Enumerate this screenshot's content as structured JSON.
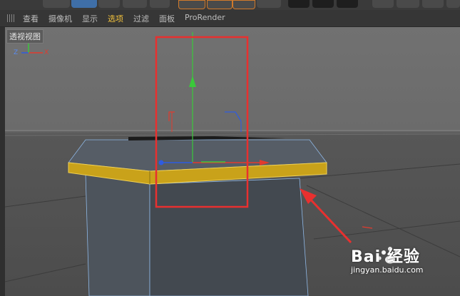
{
  "menu": {
    "items": [
      {
        "label": "查看"
      },
      {
        "label": "摄像机"
      },
      {
        "label": "显示"
      },
      {
        "label": "选项",
        "active": true
      },
      {
        "label": "过滤"
      },
      {
        "label": "面板"
      },
      {
        "label": "ProRender"
      }
    ]
  },
  "viewport": {
    "label": "透视视图",
    "axis_y": "Y",
    "axis_z": "Z",
    "axis_x": "X"
  },
  "watermark": {
    "brand": "Bai 经验",
    "url": "jingyan.baidu.com"
  },
  "colors": {
    "selection_box": "#e8302f",
    "arrow": "#e8302f",
    "x_axis": "#e23b2e",
    "y_axis": "#3ac93a",
    "z_axis": "#2f5ce0",
    "selected_face": "#c9a21a",
    "active_menu": "#f3c23c"
  }
}
